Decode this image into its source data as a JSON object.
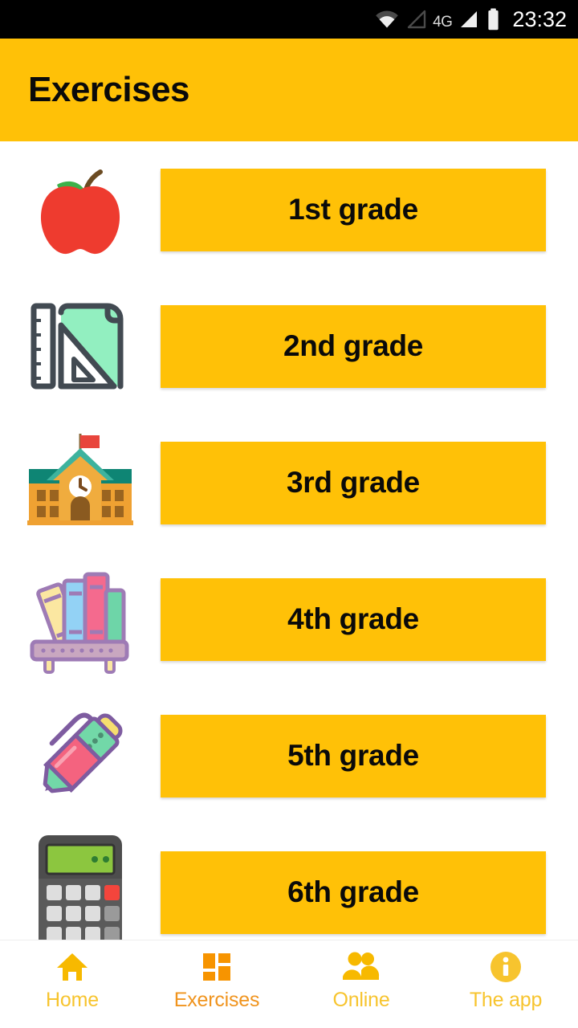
{
  "status_bar": {
    "icons": [
      "wifi-icon",
      "signal-empty-icon",
      "signal-filled-icon",
      "battery-icon"
    ],
    "network_label": "4G",
    "clock": "23:32",
    "background_color": "#000000",
    "text_color": "#ffffff"
  },
  "app_bar": {
    "title": "Exercises",
    "background_color": "#FFC107",
    "text_color": "#0a0a0a"
  },
  "theme": {
    "accent": "#FFC107",
    "nav_inactive": "#F7C42E",
    "nav_active": "#F0941E",
    "page_background": "#ffffff"
  },
  "grades": [
    {
      "label": "1st grade",
      "icon": "apple-icon"
    },
    {
      "label": "2nd grade",
      "icon": "ruler-triangle-icon"
    },
    {
      "label": "3rd grade",
      "icon": "school-building-icon"
    },
    {
      "label": "4th grade",
      "icon": "books-shelf-icon"
    },
    {
      "label": "5th grade",
      "icon": "pen-icon"
    },
    {
      "label": "6th grade",
      "icon": "calculator-icon"
    }
  ],
  "bottom_nav": {
    "active_index": 1,
    "items": [
      {
        "label": "Home",
        "icon": "home-icon"
      },
      {
        "label": "Exercises",
        "icon": "grid-icon"
      },
      {
        "label": "Online",
        "icon": "people-icon"
      },
      {
        "label": "The app",
        "icon": "info-icon"
      }
    ]
  }
}
